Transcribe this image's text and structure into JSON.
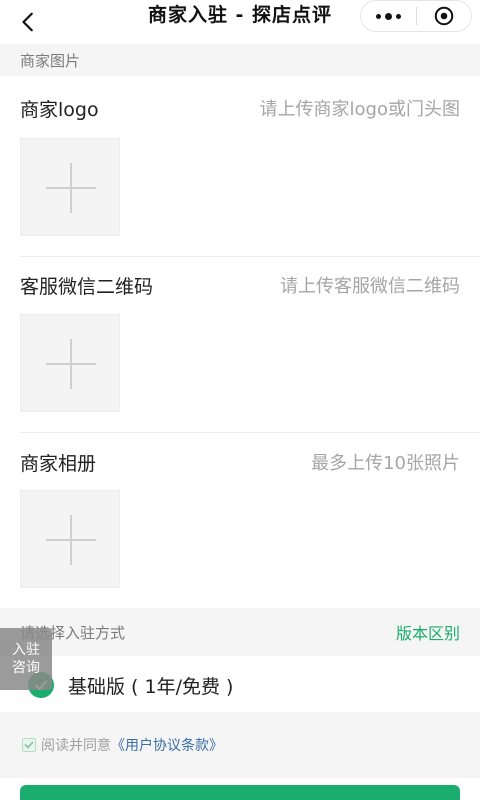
{
  "nav": {
    "title": "商家入驻 - 探店点评",
    "back_icon": "chevron-left-icon",
    "more_icon": "more-dots-icon",
    "close_icon": "target-close-icon"
  },
  "sections": {
    "images_header": "商家图片",
    "mode_header": "请选择入驻方式",
    "mode_diff_link": "版本区别"
  },
  "uploads": [
    {
      "label": "商家logo",
      "hint": "请上传商家logo或门头图"
    },
    {
      "label": "客服微信二维码",
      "hint": "请上传客服微信二维码"
    },
    {
      "label": "商家相册",
      "hint": "最多上传10张照片"
    }
  ],
  "float_tag": {
    "line1": "入驻",
    "line2": "咨询"
  },
  "plan": {
    "label": "基础版 ( 1年/免费 )",
    "selected": true
  },
  "agreement": {
    "prefix": "阅读并同意",
    "link": "《用户协议条款》",
    "checked": true
  },
  "colors": {
    "accent": "#1aad6d",
    "link": "#3a6ea5",
    "hint": "#a5a5a5"
  }
}
